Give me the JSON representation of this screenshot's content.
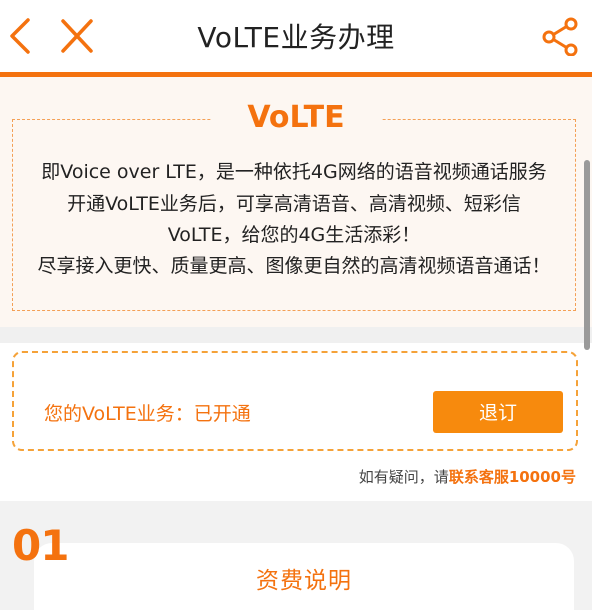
{
  "header": {
    "title": "VoLTE业务办理",
    "back_icon": "back-arrow-icon",
    "close_icon": "close-icon",
    "share_icon": "share-icon",
    "accent_color": "#f4720f"
  },
  "intro": {
    "title": "VoLTE",
    "lines": [
      "即Voice over LTE，是一种依托4G网络的语音视频通话服务",
      "开通VoLTE业务后，可享高清语音、高清视频、短彩信",
      "VoLTE，给您的4G生活添彩！",
      "尽享接入更快、质量更高、图像更自然的高清视频语音通话！"
    ]
  },
  "status": {
    "text": "您的VoLTE业务：已开通",
    "button_label": "退订"
  },
  "help": {
    "prefix": "如有疑问，请",
    "link": "联系客服10000号"
  },
  "fees": {
    "number": "01",
    "title": "资费说明"
  }
}
